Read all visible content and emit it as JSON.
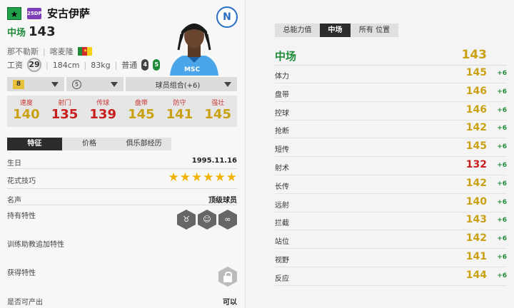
{
  "colors": {
    "gold": "#c9a113",
    "red": "#c81e1e",
    "green": "#1f8a3a"
  },
  "player": {
    "star_icon": "★",
    "season_badge": "25DP",
    "name": "安古伊萨",
    "position": "中场",
    "overall": "143",
    "club": "那不勒斯",
    "nation": "喀麦隆",
    "wage_label": "工资",
    "wage": "29",
    "height": "184cm",
    "weight": "83kg",
    "body_type": "普通",
    "weak_foot": "4",
    "strong_foot": "5",
    "club_crest_letter": "N",
    "shirt_text": "MSC"
  },
  "controls": {
    "level": "8",
    "team_color_level": "5",
    "chemistry_label": "球员组合(+6)"
  },
  "main_stats": [
    {
      "label": "速度",
      "value": "140",
      "color": "#c9a113"
    },
    {
      "label": "射门",
      "value": "135",
      "color": "#c81e1e"
    },
    {
      "label": "传球",
      "value": "139",
      "color": "#c81e1e"
    },
    {
      "label": "盘带",
      "value": "145",
      "color": "#c9a113"
    },
    {
      "label": "防守",
      "value": "141",
      "color": "#c9a113"
    },
    {
      "label": "强壮",
      "value": "145",
      "color": "#c9a113"
    }
  ],
  "tabs": [
    "特征",
    "价格",
    "俱乐部经历"
  ],
  "details": {
    "birthday_label": "生日",
    "birthday": "1995.11.16",
    "skill_label": "花式技巧",
    "skill_stars": 6,
    "reputation_label": "名声",
    "reputation": "顶级球员",
    "traits_label": "持有特性",
    "training_traits_label": "训练助教追加特性",
    "obtained_traits_label": "获得特性",
    "tradable_label": "是否可产出",
    "tradable": "可以"
  },
  "right_tabs": [
    "总能力值",
    "中场",
    "所有 位置"
  ],
  "role": {
    "name": "中场",
    "value": "143"
  },
  "attributes": [
    {
      "name": "体力",
      "value": "145",
      "bonus": "+6",
      "color": "#c9a113"
    },
    {
      "name": "盘带",
      "value": "146",
      "bonus": "+6",
      "color": "#c9a113"
    },
    {
      "name": "控球",
      "value": "146",
      "bonus": "+6",
      "color": "#c9a113"
    },
    {
      "name": "抢断",
      "value": "142",
      "bonus": "+6",
      "color": "#c9a113"
    },
    {
      "name": "短传",
      "value": "145",
      "bonus": "+6",
      "color": "#c9a113"
    },
    {
      "name": "射术",
      "value": "132",
      "bonus": "+6",
      "color": "#c81e1e"
    },
    {
      "name": "长传",
      "value": "142",
      "bonus": "+6",
      "color": "#c9a113"
    },
    {
      "name": "远射",
      "value": "140",
      "bonus": "+6",
      "color": "#c9a113"
    },
    {
      "name": "拦截",
      "value": "143",
      "bonus": "+6",
      "color": "#c9a113"
    },
    {
      "name": "站位",
      "value": "142",
      "bonus": "+6",
      "color": "#c9a113"
    },
    {
      "name": "视野",
      "value": "141",
      "bonus": "+6",
      "color": "#c9a113"
    },
    {
      "name": "反应",
      "value": "144",
      "bonus": "+6",
      "color": "#c9a113"
    }
  ]
}
